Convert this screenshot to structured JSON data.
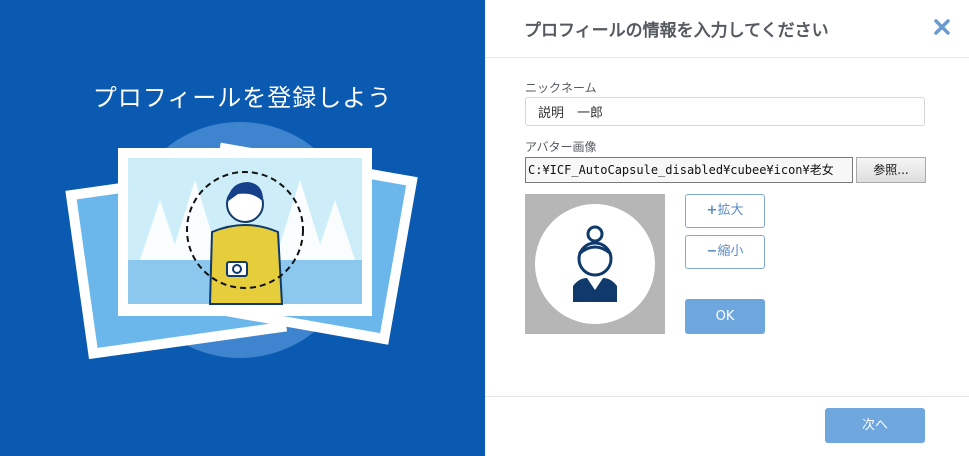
{
  "left_panel": {
    "title": "プロフィールを登録しよう"
  },
  "header": {
    "title": "プロフィールの情報を入力してください",
    "close_icon": "close-icon"
  },
  "form": {
    "nickname_label": "ニックネーム",
    "nickname_value": "説明　一郎",
    "avatar_label": "アバター画像",
    "file_path": "C:¥ICF_AutoCapsule_disabled¥cubee¥icon¥老女",
    "browse_label": "参照...",
    "zoom_in_symbol": "+",
    "zoom_in_label": "拡大",
    "zoom_out_symbol": "−",
    "zoom_out_label": "縮小",
    "ok_label": "OK"
  },
  "footer": {
    "next_label": "次へ"
  },
  "colors": {
    "left_bg": "#0b5ab2",
    "primary_button": "#6ea6de",
    "outline_button": "#5a8cc4",
    "avatar_bg": "#b6b6b6",
    "avatar_figure": "#0f3a6b"
  }
}
